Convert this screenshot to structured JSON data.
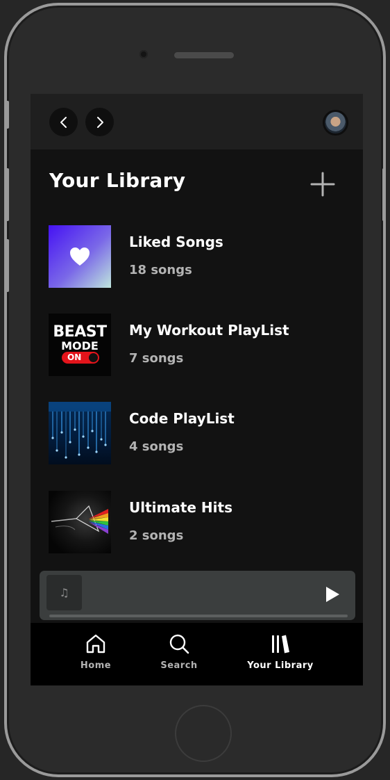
{
  "header": {
    "back_icon": "chevron-left-icon",
    "forward_icon": "chevron-right-icon",
    "avatar": "user-avatar"
  },
  "library": {
    "title": "Your Library",
    "add_icon": "plus-icon",
    "items": [
      {
        "title": "Liked Songs",
        "subtitle": "18 songs",
        "cover": "heart-icon"
      },
      {
        "title": "My Workout PlayList",
        "subtitle": "7 songs",
        "cover_line1": "BEAST",
        "cover_line2": "MODE",
        "cover_toggle": "ON"
      },
      {
        "title": "Code PlayList",
        "subtitle": "4 songs"
      },
      {
        "title": "Ultimate Hits",
        "subtitle": "2 songs"
      }
    ]
  },
  "player": {
    "thumb_glyph": "♫",
    "play_icon": "play-icon",
    "progress": 0
  },
  "tabs": [
    {
      "label": "Home",
      "icon": "home-icon",
      "active": false
    },
    {
      "label": "Search",
      "icon": "search-icon",
      "active": false
    },
    {
      "label": "Your Library",
      "icon": "library-icon",
      "active": true
    }
  ],
  "colors": {
    "background": "#121212",
    "topbar": "#1f1f1f",
    "text_primary": "#ffffff",
    "text_secondary": "#b3b3b3",
    "mini_player": "#3b3e3e",
    "tabbar": "#000000"
  }
}
